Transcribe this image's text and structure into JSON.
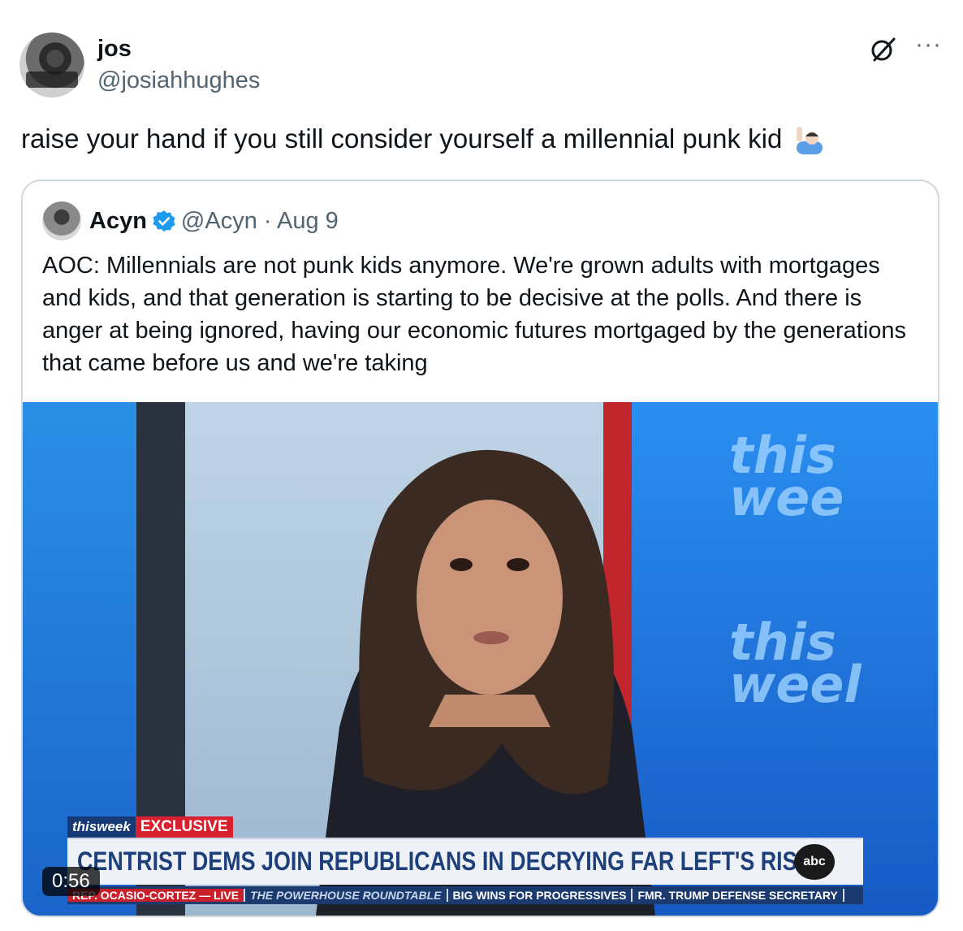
{
  "post": {
    "display_name": "jos",
    "handle": "@josiahhughes",
    "text": "raise your hand if you still consider yourself a millennial punk kid",
    "emoji_icon": "person-raising-hand-emoji"
  },
  "icons": {
    "grok": "grok-icon",
    "more": "more-icon",
    "verified": "verified-badge-icon"
  },
  "quote": {
    "display_name": "Acyn",
    "handle_date": "@Acyn · Aug 9",
    "text": "AOC: Millennials are not punk kids anymore. We're grown adults with mortgages and kids, and that generation is starting to be decisive at the polls. And there is anger at being ignored, having our economic futures mortgaged by the generations that came before us and we're taking",
    "video": {
      "duration": "0:56",
      "overlay": {
        "brand": "thisweek",
        "tag": "EXCLUSIVE",
        "headline": "CENTRIST DEMS JOIN REPUBLICANS IN DECRYING FAR LEFT'S RISE",
        "network_logo": "abc",
        "ticker": [
          "REP. OCASIO-CORTEZ — LIVE",
          "THE POWERHOUSE ROUNDTABLE",
          "BIG WINS FOR PROGRESSIVES",
          "FMR. TRUMP DEFENSE SECRETARY"
        ],
        "background_logo_lines": [
          "this",
          "wee",
          "this",
          "weel"
        ]
      }
    }
  },
  "colors": {
    "accent": "#1d9bf0",
    "muted_text": "#536471",
    "border": "#cfd9de"
  }
}
